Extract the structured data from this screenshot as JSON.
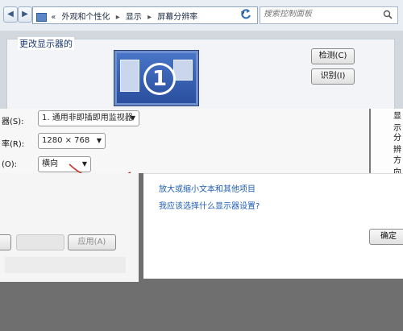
{
  "address_bar": {
    "crumbs": [
      "外观和个性化",
      "显示",
      "屏幕分辨率"
    ],
    "back_icon": "back-arrow-icon",
    "crumb_prefix": "«",
    "search_placeholder": "搜索控制面板"
  },
  "preview": {
    "title": "更改显示器的",
    "monitor_number": "1",
    "detect_label": "检测(C)",
    "identify_label": "识别(I)"
  },
  "settings": {
    "display_label": "器(S):",
    "display_value": "1. 通用非即插即用监视器",
    "resolution_label": "率(R):",
    "resolution_value": "1280 × 768",
    "orientation_label": "(O):",
    "orientation_value": "横向",
    "right_labels": [
      "显示",
      "分辨",
      "方向"
    ]
  },
  "links": {
    "text_size": "放大或缩小文本和其他项目",
    "which_settings": "我应该选择什么显示器设置?"
  },
  "buttons": {
    "ok": "确定",
    "apply": "应用(A)"
  },
  "colors": {
    "link": "#1f5db3",
    "annotation": "#c0392b",
    "monitor_blue": "#3a63b8"
  }
}
